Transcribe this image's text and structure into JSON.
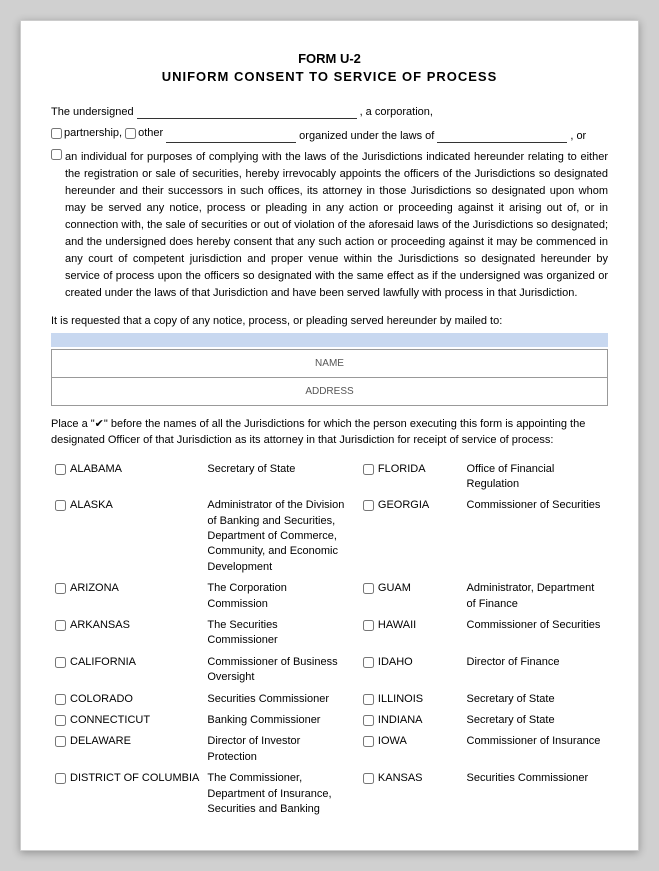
{
  "title": {
    "line1": "FORM U-2",
    "line2": "UNIFORM CONSENT TO SERVICE OF PROCESS"
  },
  "intro": {
    "text1": "The undersigned",
    "text2": ", a corporation,",
    "text3": "partnership,",
    "text4": "other",
    "text5": "organized under the laws of",
    "text6": ", or",
    "text7": "an individual for purposes of complying with the laws of the Jurisdictions indicated hereunder relating to either the registration or sale of securities, hereby irrevocably appoints the officers of the Jurisdictions so designated hereunder and their successors in such offices, its attorney in those Jurisdictions so designated upon whom may be served any notice, process or pleading in any action or proceeding against it arising out of, or in connection with, the sale of securities or out of violation of the aforesaid laws of the Jurisdictions so designated; and the undersigned does hereby consent that any such action or proceeding against it may be commenced in any court of competent jurisdiction and proper venue within the Jurisdictions so designated hereunder by service of process upon the officers so designated with the same effect as if the undersigned was organized or created under the laws of that Jurisdiction and have been served lawfully with process in that Jurisdiction.",
    "copy_text": "It is requested that a copy of any notice, process, or pleading served hereunder by mailed to:",
    "name_label": "NAME",
    "address_label": "ADDRESS"
  },
  "place_instruction": "Place a \"✔\" before the names of all the Jurisdictions for which the person executing this form is appointing the designated Officer of that Jurisdiction as its attorney in that Jurisdiction for receipt of service of process:",
  "jurisdictions_left": [
    {
      "name": "ALABAMA",
      "officer": "Secretary of State"
    },
    {
      "name": "ALASKA",
      "officer": "Administrator of the Division of Banking and Securities, Department of Commerce, Community, and Economic Development"
    },
    {
      "name": "ARIZONA",
      "officer": "The Corporation Commission"
    },
    {
      "name": "ARKANSAS",
      "officer": "The Securities Commissioner"
    },
    {
      "name": "CALIFORNIA",
      "officer": "Commissioner of Business Oversight"
    },
    {
      "name": "COLORADO",
      "officer": "Securities Commissioner"
    },
    {
      "name": "CONNECTICUT",
      "officer": "Banking Commissioner"
    },
    {
      "name": "DELAWARE",
      "officer": "Director of Investor Protection"
    },
    {
      "name": "DISTRICT OF COLUMBIA",
      "officer": "The Commissioner, Department of Insurance, Securities and Banking"
    }
  ],
  "jurisdictions_right": [
    {
      "name": "FLORIDA",
      "officer": "Office of Financial Regulation"
    },
    {
      "name": "GEORGIA",
      "officer": "Commissioner of Securities"
    },
    {
      "name": "GUAM",
      "officer": "Administrator, Department of Finance"
    },
    {
      "name": "HAWAII",
      "officer": "Commissioner of Securities"
    },
    {
      "name": "IDAHO",
      "officer": "Director of Finance"
    },
    {
      "name": "ILLINOIS",
      "officer": "Secretary of State"
    },
    {
      "name": "INDIANA",
      "officer": "Secretary of State"
    },
    {
      "name": "IOWA",
      "officer": "Commissioner of Insurance"
    },
    {
      "name": "KANSAS",
      "officer": "Securities Commissioner"
    }
  ]
}
